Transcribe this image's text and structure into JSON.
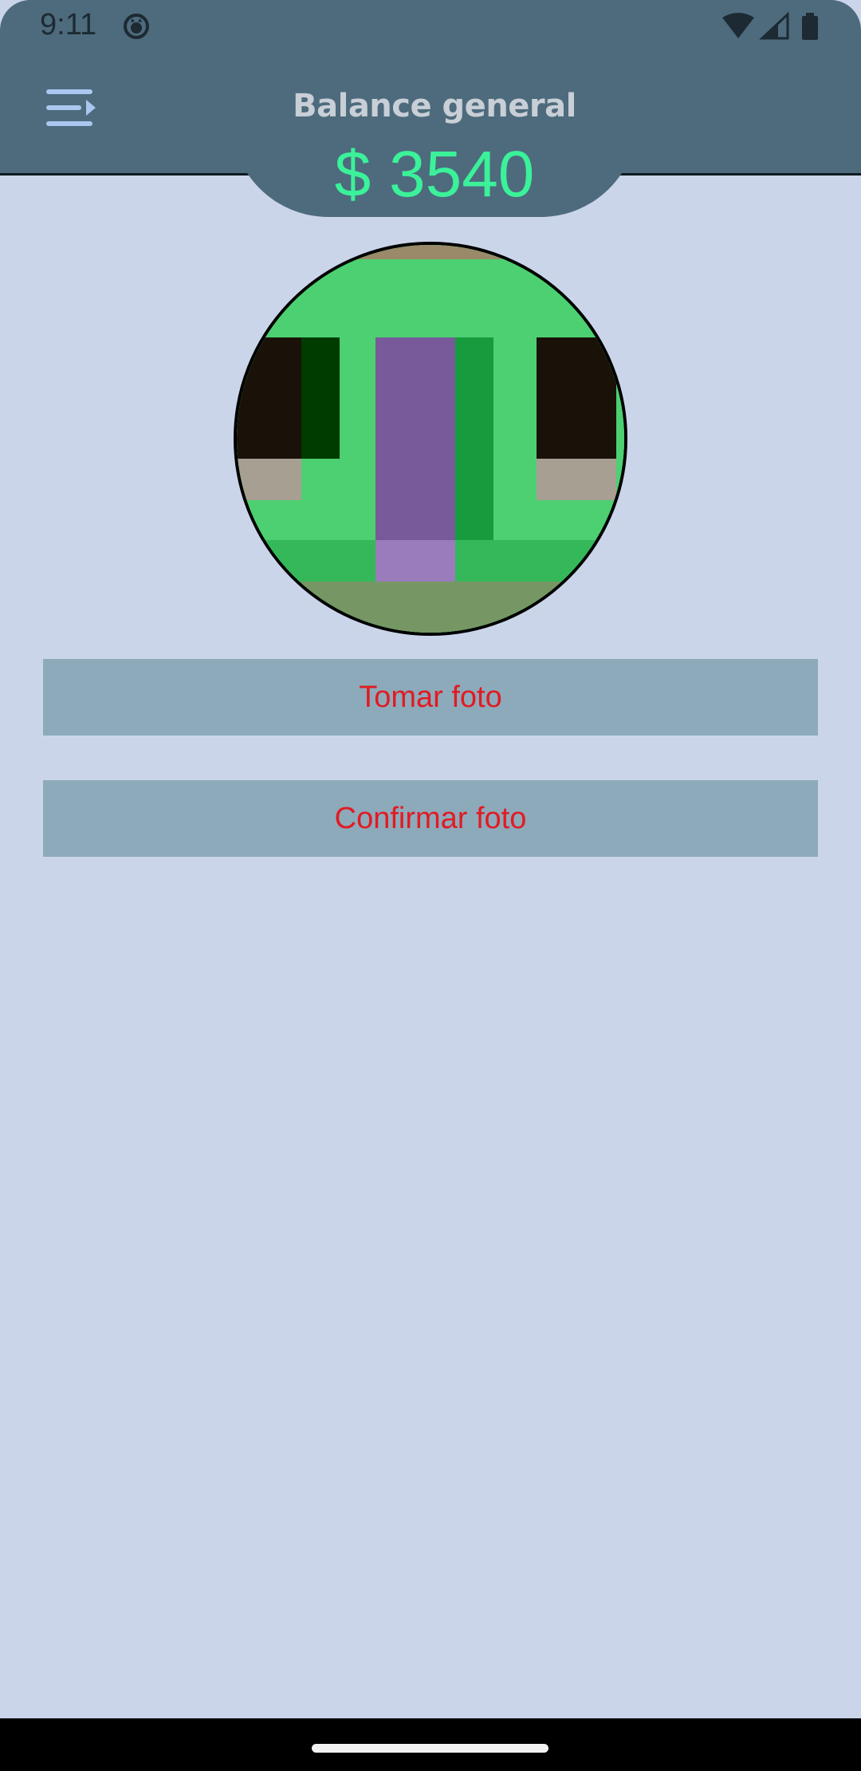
{
  "status_bar": {
    "time": "9:11",
    "icons": [
      "app-notification-icon",
      "wifi-icon",
      "signal-icon",
      "battery-icon"
    ]
  },
  "header": {
    "menu_icon": "menu-icon",
    "title": "Balance general",
    "amount": "$ 3540"
  },
  "actions": {
    "take_photo_label": "Tomar foto",
    "confirm_photo_label": "Confirmar foto"
  },
  "colors": {
    "header_bg": "#4d6b7d",
    "page_bg": "#cbd5ea",
    "amount": "#3bf199",
    "button_bg": "#8daabb",
    "button_text": "#e11b22"
  }
}
